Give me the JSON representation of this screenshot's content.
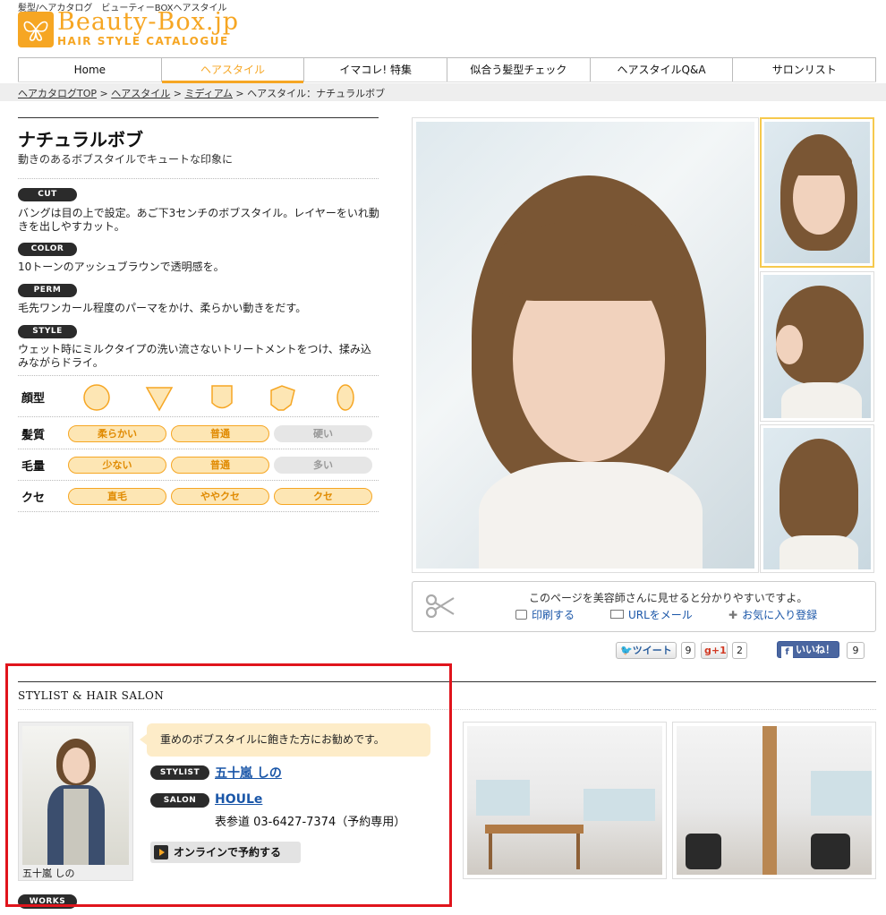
{
  "header": {
    "tagline": "髪型/ヘアカタログ　ビューティーBOXヘアスタイル",
    "logo_text": "Beauty-Box.jp",
    "logo_sub": "HAIR STYLE CATALOGUE"
  },
  "nav": {
    "items": [
      "Home",
      "ヘアスタイル",
      "イマコレ! 特集",
      "似合う髪型チェック",
      "ヘアスタイルQ&A",
      "サロンリスト"
    ],
    "active_index": 1
  },
  "breadcrumb": {
    "links": [
      "ヘアカタログTOP",
      "ヘアスタイル",
      "ミディアム"
    ],
    "separator": " > ",
    "current": "ヘアスタイル：ナチュラルボブ"
  },
  "style": {
    "title": "ナチュラルボブ",
    "subtitle": "動きのあるボブスタイルでキュートな印象に",
    "sections": [
      {
        "tag": "CUT",
        "text": "バングは目の上で設定。あご下3センチのボブスタイル。レイヤーをいれ動きを出しやすカット。"
      },
      {
        "tag": "COLOR",
        "text": "10トーンのアッシュブラウンで透明感を。"
      },
      {
        "tag": "PERM",
        "text": "毛先ワンカール程度のパーマをかけ、柔らかい動きをだす。"
      },
      {
        "tag": "STYLE",
        "text": "ウェット時にミルクタイプの洗い流さないトリートメントをつけ、揉み込みながらドライ。"
      }
    ]
  },
  "attributes": {
    "face_label": "顔型",
    "face_shapes": [
      "round-icon",
      "triangle-icon",
      "base-icon",
      "pentagon-icon",
      "oval-icon"
    ],
    "rows": [
      {
        "label": "髪質",
        "chips": [
          {
            "text": "柔らかい",
            "on": true
          },
          {
            "text": "普通",
            "on": true
          },
          {
            "text": "硬い",
            "on": false
          }
        ]
      },
      {
        "label": "毛量",
        "chips": [
          {
            "text": "少ない",
            "on": true
          },
          {
            "text": "普通",
            "on": true
          },
          {
            "text": "多い",
            "on": false
          }
        ]
      },
      {
        "label": "クセ",
        "chips": [
          {
            "text": "直毛",
            "on": true
          },
          {
            "text": "ややクセ",
            "on": true
          },
          {
            "text": "クセ",
            "on": true
          }
        ]
      }
    ],
    "colors": {
      "accent": "#f6a623",
      "chip_on_bg": "#fde6b4",
      "chip_off_bg": "#e6e6e6"
    }
  },
  "tips": {
    "text": "このページを美容師さんに見せると分かりやすいですよ。",
    "print": "印刷する",
    "mail": "URLをメール",
    "favorite": "お気に入り登録"
  },
  "social": {
    "tweet": "ツイート",
    "tweet_count": "9",
    "gplus": "+1",
    "gplus_count": "2",
    "like": "いいね！",
    "like_count": "9"
  },
  "stylist": {
    "section_title": "STYLIST & HAIR SALON",
    "comment": "重めのボブスタイルに飽きた方にお勧めです。",
    "stylist_tag": "STYLIST",
    "stylist_name": "五十嵐 しの",
    "photo_caption": "五十嵐 しの",
    "salon_tag": "SALON",
    "salon_name": "HOULe",
    "salon_phone": "表参道 03-6427-7374（予約専用）",
    "reserve": "オンラインで予約する",
    "works_tag": "WORKS"
  }
}
